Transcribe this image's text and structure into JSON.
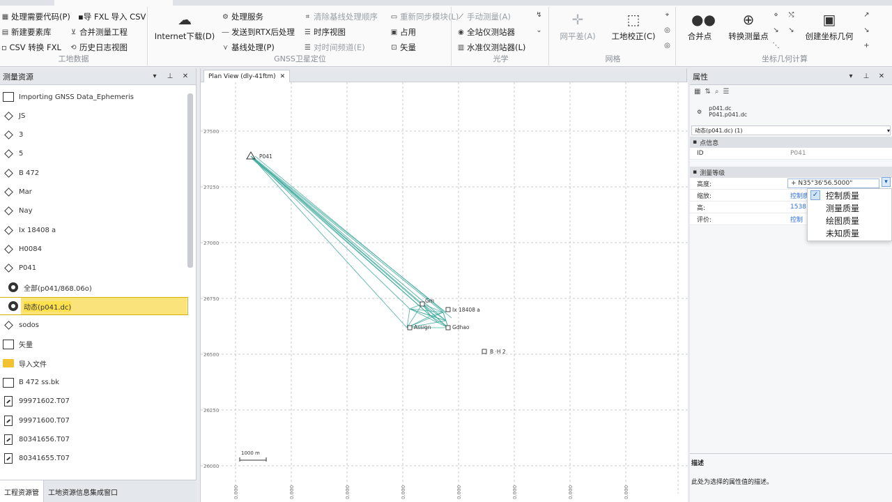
{
  "ribbon": {
    "groups": [
      {
        "label": "工地数据",
        "items": [
          "处理需要代码(P)",
          "▪导 FXL 导入 CSV",
          "新建要素库",
          "合并测量工程",
          "▫ CSV 转换 FXL",
          "历史日志视图"
        ]
      },
      {
        "label": "GNSS卫星定位",
        "big": "Internet下载(D)",
        "items": [
          "处理服务",
          "发送到RTX后处理",
          "基线处理(P)",
          "清除基线处理顺序",
          "时序视图",
          "对时间频道(E)",
          "重新同步模块(L)",
          "占用",
          "矢量"
        ]
      },
      {
        "label": "光学",
        "items": [
          "手动测量(A)",
          "全站仪测站器",
          "水准仪测站器(L)"
        ]
      },
      {
        "label": "网格",
        "bigs": [
          "网平差(A)",
          "工地校正(C)"
        ]
      },
      {
        "label": "坐标几何计算",
        "bigs": [
          "合并点",
          "转换测量点",
          "创建坐标几何"
        ]
      }
    ]
  },
  "left_panel": {
    "title": "测量资源",
    "items": [
      {
        "label": "Importing GNSS Data_Ephemeris",
        "icon": "box-icon"
      },
      {
        "label": "JS",
        "icon": "point-diamond-icon"
      },
      {
        "label": "3",
        "icon": "point-diamond-icon"
      },
      {
        "label": "5",
        "icon": "point-diamond-icon"
      },
      {
        "label": "B 472",
        "icon": "point-diamond-icon"
      },
      {
        "label": "Mar",
        "icon": "point-diamond-icon"
      },
      {
        "label": "Nay",
        "icon": "point-diamond-icon"
      },
      {
        "label": "Ix 18408 a",
        "icon": "point-diamond-icon"
      },
      {
        "label": "H0084",
        "icon": "point-diamond-icon"
      },
      {
        "label": "P041",
        "icon": "point-diamond-icon"
      },
      {
        "label": "全部(p041/868.06o)",
        "icon": "gear-icon"
      },
      {
        "label": "动态(p041.dc)",
        "icon": "gear-icon",
        "selected": true
      },
      {
        "label": "sodos",
        "icon": "point-diamond-icon"
      },
      {
        "label": "矢量",
        "icon": "box-icon"
      },
      {
        "label": "导入文件",
        "icon": "folder-icon"
      },
      {
        "label": "B 472 ss.bk",
        "icon": "file-icon"
      },
      {
        "label": "99971602.T07",
        "icon": "document-icon"
      },
      {
        "label": "99971600.T07",
        "icon": "document-icon"
      },
      {
        "label": "80341656.T07",
        "icon": "document-icon"
      },
      {
        "label": "80341655.T07",
        "icon": "document-icon"
      }
    ],
    "bottom_tabs": [
      "工程资源管",
      "工地资源信息集成窗口"
    ]
  },
  "center": {
    "tab_label": "Plan View (dly-41ftm)",
    "y_ticks": [
      "27500",
      "27250",
      "27000",
      "26750",
      "26500",
      "26250",
      "26000"
    ],
    "x_ticks": [
      "0.000",
      "0.000",
      "0.000",
      "0.000",
      "0.000",
      "0.000",
      "0.000",
      "0.000"
    ],
    "points": [
      {
        "label": "P041",
        "symbol": "triangle"
      },
      {
        "label": "Ix 18408 a",
        "symbol": "square"
      },
      {
        "label": "Assign",
        "symbol": "square"
      },
      {
        "label": "Gdhao",
        "symbol": "square"
      },
      {
        "label": "Gm",
        "symbol": "square"
      },
      {
        "label": "B ·H 2",
        "symbol": "square"
      }
    ],
    "scale_label": "1000 m"
  },
  "right_panel": {
    "title": "属性",
    "files": [
      "p041.dc",
      "P041.p041.dc"
    ],
    "selector": "动态(p041.dc) (1)",
    "categories": [
      {
        "label": "点信息",
        "rows": [
          {
            "key": "ID",
            "value": "P041"
          }
        ]
      },
      {
        "label": "测量等级",
        "rows": [
          {
            "key": "高度:",
            "value": "+ N35°36'56.5000\""
          },
          {
            "key": "缩放:",
            "value": "控制质量"
          },
          {
            "key": "高:",
            "value": "1538"
          },
          {
            "key": "评价:",
            "value": "控制"
          }
        ]
      }
    ],
    "dropdown": [
      "控制质量",
      "测量质量",
      "绘图质量",
      "未知质量"
    ],
    "description_title": "描述",
    "description_text": "此处为选择的属性值的描述。"
  }
}
